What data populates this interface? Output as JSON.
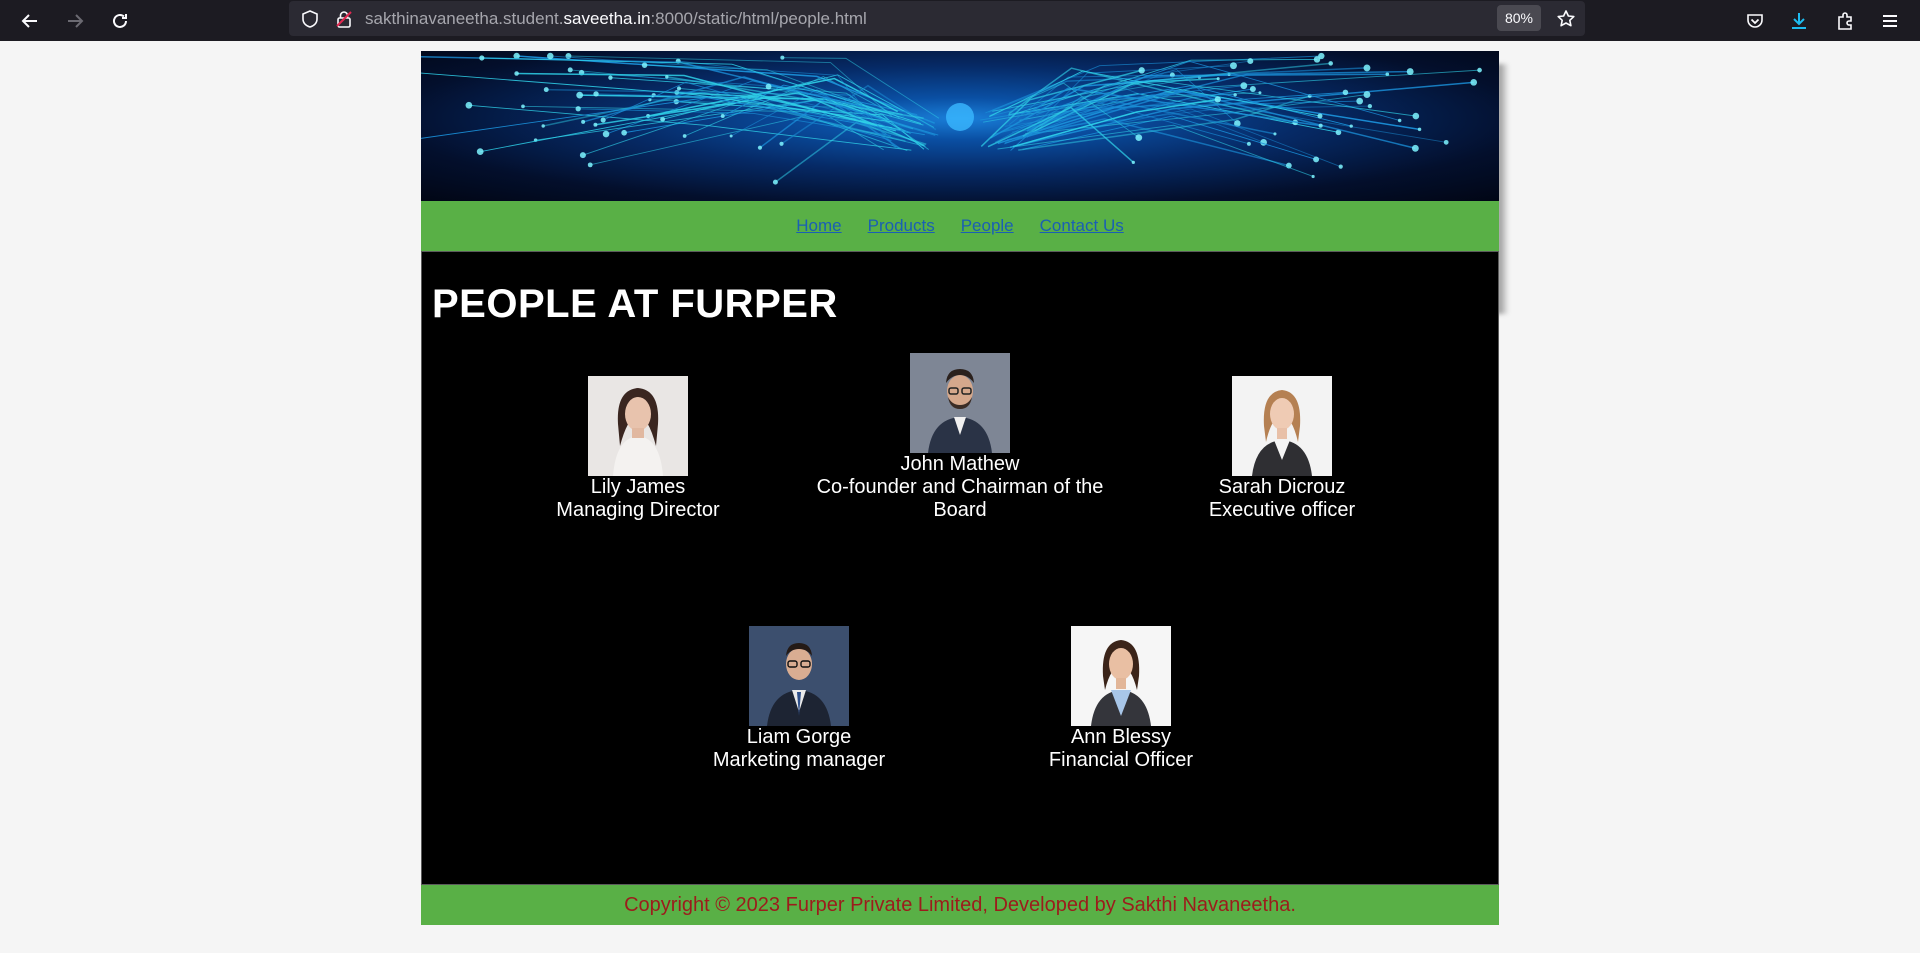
{
  "browser": {
    "url_prefix": "sakthinavaneetha.student.",
    "url_host": "saveetha.in",
    "url_suffix": ":8000/static/html/people.html",
    "zoom": "80%"
  },
  "nav": {
    "items": [
      "Home",
      "Products",
      "People",
      "Contact Us"
    ]
  },
  "main": {
    "title": "PEOPLE AT FURPER",
    "people": [
      {
        "name": "Lily James",
        "role": "Managing Director"
      },
      {
        "name": "John Mathew",
        "role": "Co-founder and Chairman of the Board"
      },
      {
        "name": "Sarah Dicrouz",
        "role": "Executive officer"
      },
      {
        "name": "Liam Gorge",
        "role": "Marketing manager"
      },
      {
        "name": "Ann Blessy",
        "role": "Financial Officer"
      }
    ]
  },
  "footer": {
    "text": "Copyright © 2023 Furper Private Limited, Developed by Sakthi Navaneetha."
  },
  "colors": {
    "nav_bg": "#59b046",
    "content_bg": "#000000",
    "footer_text": "#9c1c1c",
    "link": "#1a5fb4"
  }
}
